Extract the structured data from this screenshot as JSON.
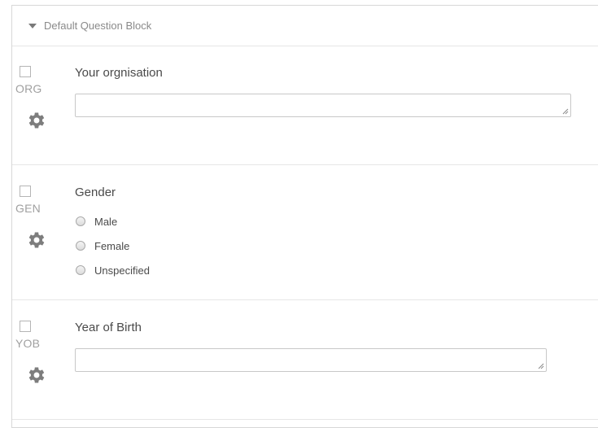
{
  "block": {
    "title": "Default Question Block",
    "caret_icon": "caret-down-icon",
    "questions": [
      {
        "export_tag": "ORG",
        "text": "Your orgnisation",
        "type": "text-entry",
        "value": "",
        "gear_icon": "gear-icon"
      },
      {
        "export_tag": "GEN",
        "text": "Gender",
        "type": "multiple-choice",
        "choices": [
          "Male",
          "Female",
          "Unspecified"
        ],
        "gear_icon": "gear-icon"
      },
      {
        "export_tag": "YOB",
        "text": "Year of Birth",
        "type": "text-entry",
        "value": "",
        "gear_icon": "gear-icon"
      }
    ]
  },
  "colors": {
    "border": "#d7d7d7",
    "divider": "#e6e6e6",
    "question_text": "#4a4a4a",
    "muted_text": "#8a8a8a",
    "gear": "#7d7d7d"
  }
}
